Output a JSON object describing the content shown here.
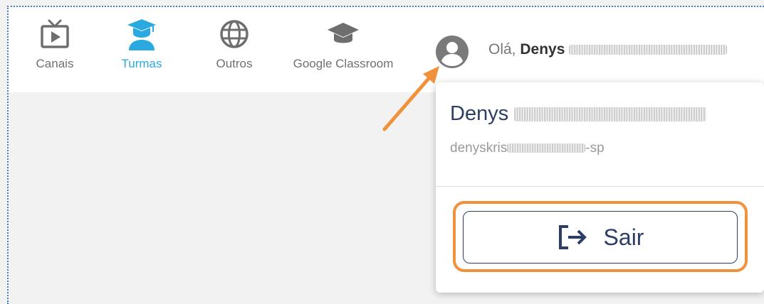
{
  "nav": {
    "items": [
      {
        "label": "Canais",
        "icon": "tv-play-icon"
      },
      {
        "label": "Turmas",
        "icon": "graduate-student-icon",
        "active": true
      },
      {
        "label": "Outros",
        "icon": "globe-icon"
      },
      {
        "label": "Google Classroom",
        "icon": "graduation-cap-icon"
      }
    ]
  },
  "user": {
    "greeting_prefix": "Olá,",
    "first_name": "Denys",
    "full_name_first": "Denys",
    "email_visible": "denyskris",
    "email_suffix": "-sp"
  },
  "menu": {
    "logout_label": "Sair"
  },
  "colors": {
    "accent": "#2aa8e0",
    "primary_text": "#2d3e66",
    "highlight": "#f0913c"
  }
}
